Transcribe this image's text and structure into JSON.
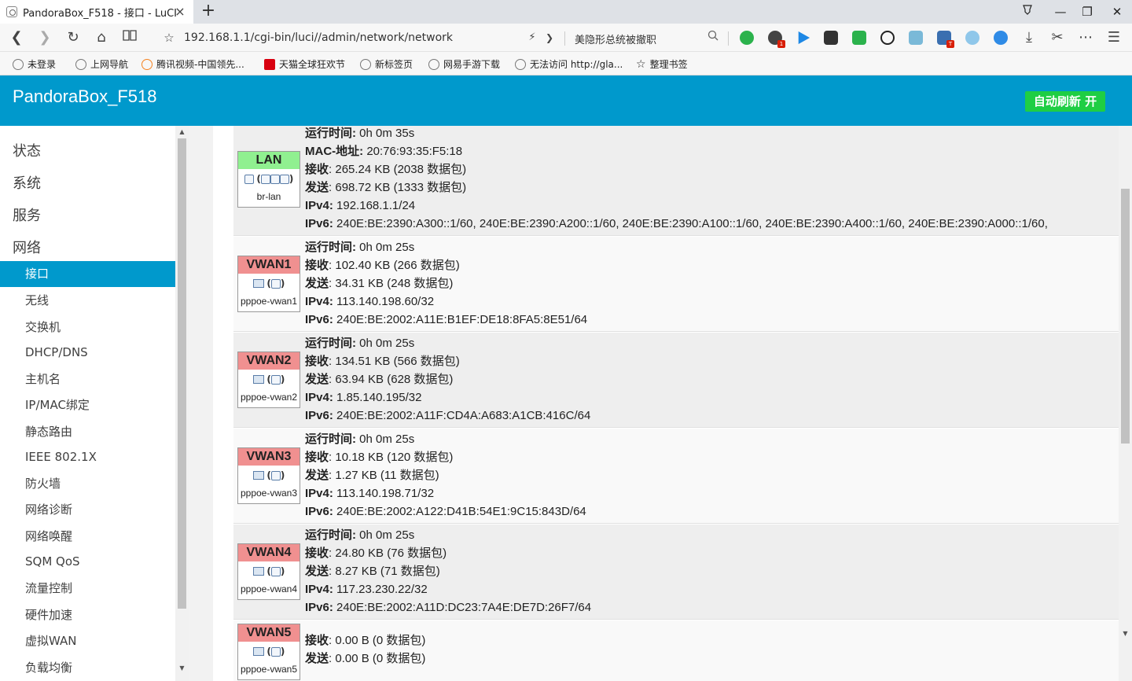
{
  "browser": {
    "tab_title": "PandoraBox_F518 - 接口 - LuCI",
    "tab_close": "×",
    "new_tab": "+",
    "url": "192.168.1.1/cgi-bin/luci//admin/network/network",
    "search_text": "美隐形总统被撤职",
    "window_controls": {
      "minimize": "—",
      "restore": "❐",
      "close": "✕"
    },
    "bookmarks": [
      {
        "label": "未登录",
        "icon": "user-icon"
      },
      {
        "label": "上网导航",
        "icon": "globe-icon"
      },
      {
        "label": "腾讯视频-中国领先...",
        "icon": "tencent-video-icon"
      },
      {
        "label": "天猫全球狂欢节",
        "icon": "tmall-icon"
      },
      {
        "label": "新标签页",
        "icon": "globe-icon"
      },
      {
        "label": "网易手游下载",
        "icon": "globe-icon"
      },
      {
        "label": "无法访问 http://gla...",
        "icon": "globe-icon"
      },
      {
        "label": "整理书签",
        "icon": "star-icon"
      }
    ]
  },
  "header": {
    "brand": "PandoraBox_F518",
    "autorefresh": "自动刷新 开",
    "colors": {
      "header_bg": "#0099cc",
      "autorefresh_bg": "#1fce44"
    }
  },
  "sidebar": {
    "top_items": [
      "状态",
      "系统",
      "服务",
      "网络"
    ],
    "sub_items": [
      "接口",
      "无线",
      "交换机",
      "DHCP/DNS",
      "主机名",
      "IP/MAC绑定",
      "静态路由",
      "IEEE 802.1X",
      "防火墙",
      "网络诊断",
      "网络唤醒",
      "SQM QoS",
      "流量控制",
      "硬件加速",
      "虚拟WAN",
      "负载均衡"
    ],
    "active": "接口"
  },
  "labels": {
    "uptime": "运行时间:",
    "mac": "MAC-地址:",
    "rx": "接收",
    "tx": "发送",
    "ipv4": "IPv4:",
    "ipv6": "IPv6:"
  },
  "interfaces": [
    {
      "name": "LAN",
      "device": "br-lan",
      "type": "lan",
      "uptime": "0h 0m 35s",
      "mac": "20:76:93:35:F5:18",
      "rx": ": 265.24 KB (2038 数据包)",
      "tx": ": 698.72 KB (1333 数据包)",
      "ipv4": "192.168.1.1/24",
      "ipv6": "240E:BE:2390:A300::1/60, 240E:BE:2390:A200::1/60, 240E:BE:2390:A100::1/60, 240E:BE:2390:A400::1/60, 240E:BE:2390:A000::1/60,"
    },
    {
      "name": "VWAN1",
      "device": "pppoe-vwan1",
      "type": "wan",
      "uptime": "0h 0m 25s",
      "rx": ": 102.40 KB (266 数据包)",
      "tx": ": 34.31 KB (248 数据包)",
      "ipv4": "113.140.198.60/32",
      "ipv6": "240E:BE:2002:A11E:B1EF:DE18:8FA5:8E51/64"
    },
    {
      "name": "VWAN2",
      "device": "pppoe-vwan2",
      "type": "wan",
      "uptime": "0h 0m 25s",
      "rx": ": 134.51 KB (566 数据包)",
      "tx": ": 63.94 KB (628 数据包)",
      "ipv4": "1.85.140.195/32",
      "ipv6": "240E:BE:2002:A11F:CD4A:A683:A1CB:416C/64"
    },
    {
      "name": "VWAN3",
      "device": "pppoe-vwan3",
      "type": "wan",
      "uptime": "0h 0m 25s",
      "rx": ": 10.18 KB (120 数据包)",
      "tx": ": 1.27 KB (11 数据包)",
      "ipv4": "113.140.198.71/32",
      "ipv6": "240E:BE:2002:A122:D41B:54E1:9C15:843D/64"
    },
    {
      "name": "VWAN4",
      "device": "pppoe-vwan4",
      "type": "wan",
      "uptime": "0h 0m 25s",
      "rx": ": 24.80 KB (76 数据包)",
      "tx": ": 8.27 KB (71 数据包)",
      "ipv4": "117.23.230.22/32",
      "ipv6": "240E:BE:2002:A11D:DC23:7A4E:DE7D:26F7/64"
    },
    {
      "name": "VWAN5",
      "device": "pppoe-vwan5",
      "type": "wan",
      "rx": ": 0.00 B (0 数据包)",
      "tx": ": 0.00 B (0 数据包)"
    }
  ]
}
